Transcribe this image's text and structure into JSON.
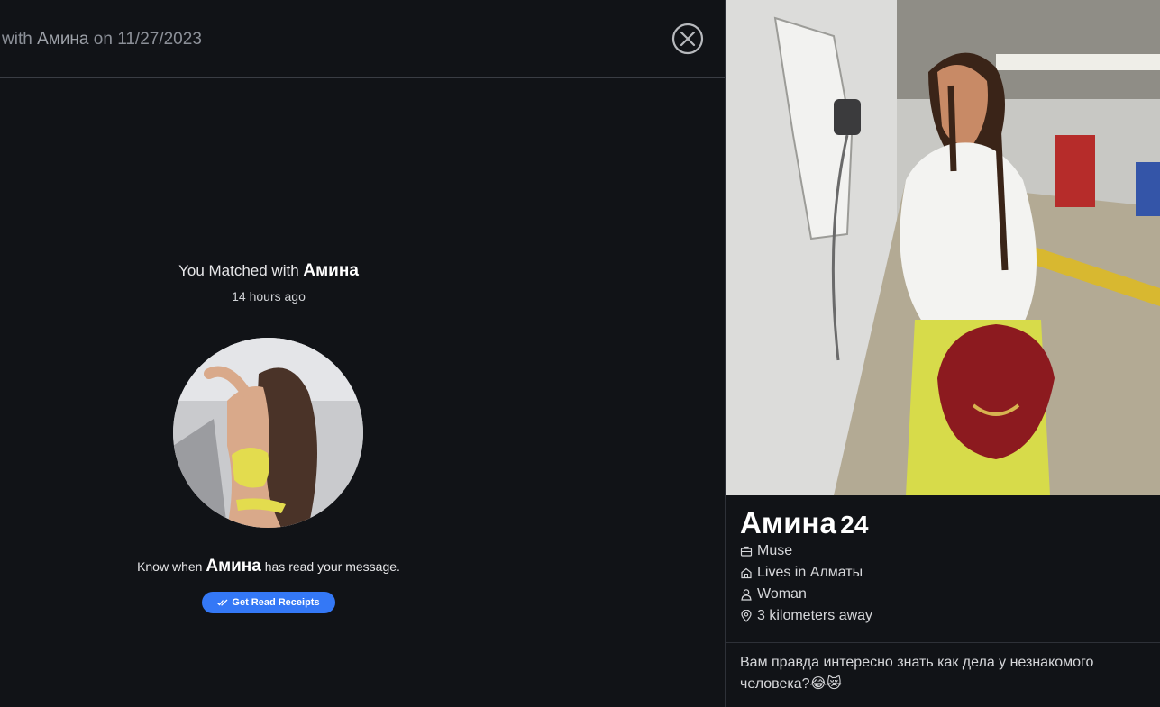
{
  "header": {
    "prefix": "with",
    "name": "Амина",
    "on_text": "on",
    "date": "11/27/2023"
  },
  "match": {
    "title_prefix": "You Matched with",
    "name": "Амина",
    "time_ago": "14 hours ago"
  },
  "read_receipts": {
    "text_prefix": "Know when",
    "name": "Амина",
    "text_suffix": "has read your message.",
    "button_label": "Get Read Receipts"
  },
  "profile": {
    "name": "Амина",
    "age": "24",
    "job": "Muse",
    "lives": "Lives in Алматы",
    "gender": "Woman",
    "distance": "3 kilometers away",
    "bio": "Вам правда интересно знать как дела у незнакомого человека?😂😿"
  },
  "colors": {
    "background": "#111317",
    "accent_button": "#3478f6",
    "muted_text": "#8c9098"
  },
  "icons": {
    "close": "close-circle-icon",
    "read_check": "double-check-icon",
    "job": "briefcase-icon",
    "lives": "home-icon",
    "gender": "person-icon",
    "distance": "location-pin-icon"
  }
}
